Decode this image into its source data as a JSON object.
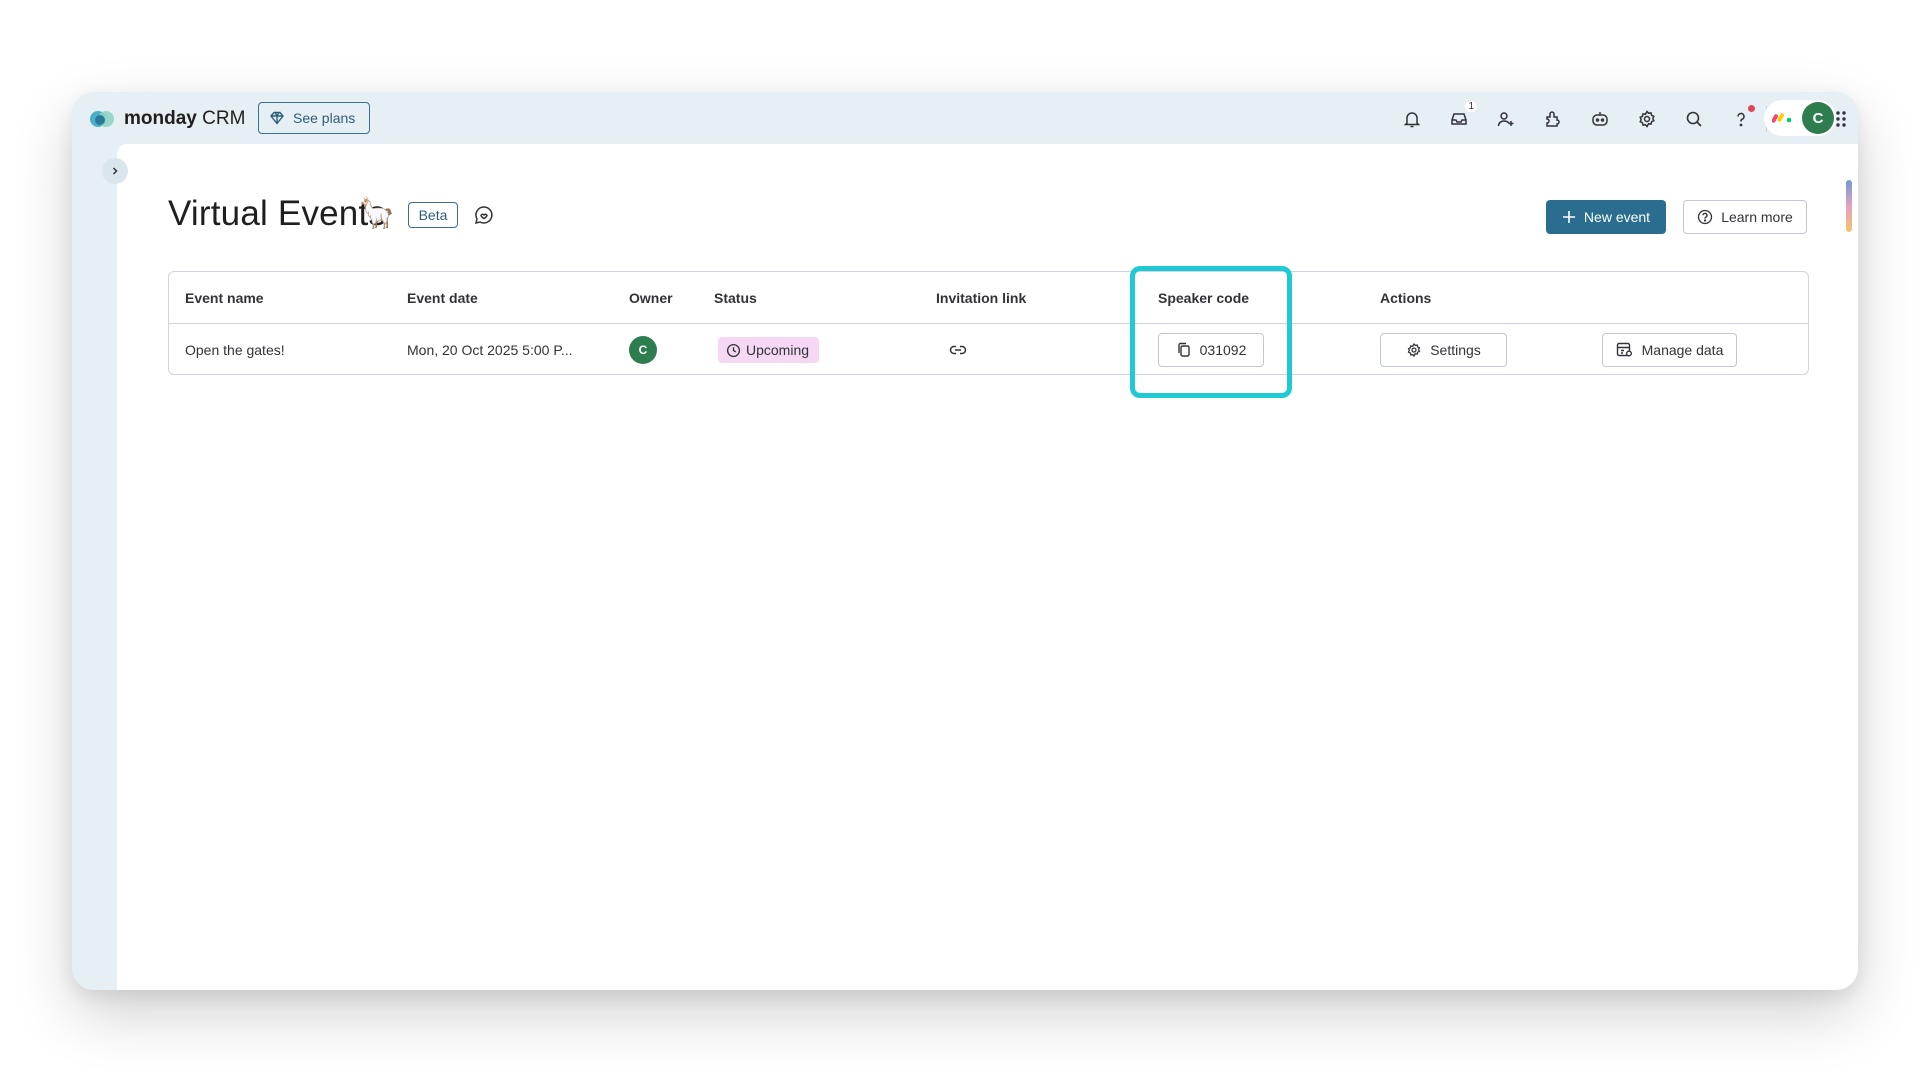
{
  "app": {
    "brand_bold": "monday",
    "brand_light": " CRM",
    "see_plans_label": "See plans"
  },
  "topbar": {
    "icons": [
      "bell-icon",
      "inbox-icon",
      "invite-user-icon",
      "apps-icon",
      "ai-icon",
      "settings-icon",
      "search-icon",
      "help-icon",
      "heart-icon",
      "grid-menu-icon"
    ],
    "inbox_badge": "1",
    "user_initial": "C"
  },
  "page": {
    "title": "Virtual Events",
    "title_emoji": "🦙",
    "beta_label": "Beta",
    "new_event_label": "New event",
    "learn_more_label": "Learn more"
  },
  "table": {
    "columns": [
      "Event name",
      "Event date",
      "Owner",
      "Status",
      "Invitation link",
      "Speaker code",
      "Actions"
    ],
    "rows": [
      {
        "event_name": "Open the gates!",
        "event_date": "Mon, 20 Oct 2025 5:00 P...",
        "owner_initial": "C",
        "status": "Upcoming",
        "speaker_code": "031092",
        "settings_label": "Settings",
        "manage_data_label": "Manage data"
      }
    ]
  },
  "colors": {
    "accent": "#2a6d8f",
    "highlight": "#1ecad3",
    "status_upcoming_bg": "#f6d8f5",
    "avatar": "#2e7d4f"
  }
}
